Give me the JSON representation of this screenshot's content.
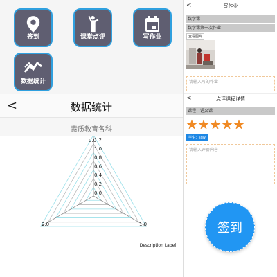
{
  "tiles": [
    {
      "label": "签到",
      "icon": "location-pin-icon"
    },
    {
      "label": "课堂点评",
      "icon": "person-raise-hand-icon"
    },
    {
      "label": "写作业",
      "icon": "calendar-icon"
    },
    {
      "label": "数据统计",
      "icon": "trend-chart-icon"
    }
  ],
  "navbar": {
    "back": "<",
    "title": "数据统计"
  },
  "chart_data": {
    "type": "radar",
    "subtitle": "素质教育各科",
    "axes_max_labels": [
      "0.0",
      "1.0",
      "2.0"
    ],
    "tick_labels": [
      "1.2",
      "1.0",
      "0.8",
      "0.6",
      "0.4",
      "0.2",
      "0.0"
    ],
    "description_label": "Description Label",
    "grid": true
  },
  "homework": {
    "back": "<",
    "title": "写作业",
    "course": "数学课",
    "assignment": "数学课第一次作业",
    "view_images": "查看图片",
    "placeholder": "请输入写的作业"
  },
  "review": {
    "back": "<",
    "title": "点评课程详情",
    "course": "课程：语文课",
    "rating": 5,
    "student": "学生：sdw",
    "placeholder": "请输入评价内容"
  },
  "fab": {
    "label": "签到"
  },
  "colors": {
    "tile_bg": "#5f5e71",
    "tile_border": "#2fa0df",
    "accent": "#2196f3",
    "star": "#f08a24"
  }
}
